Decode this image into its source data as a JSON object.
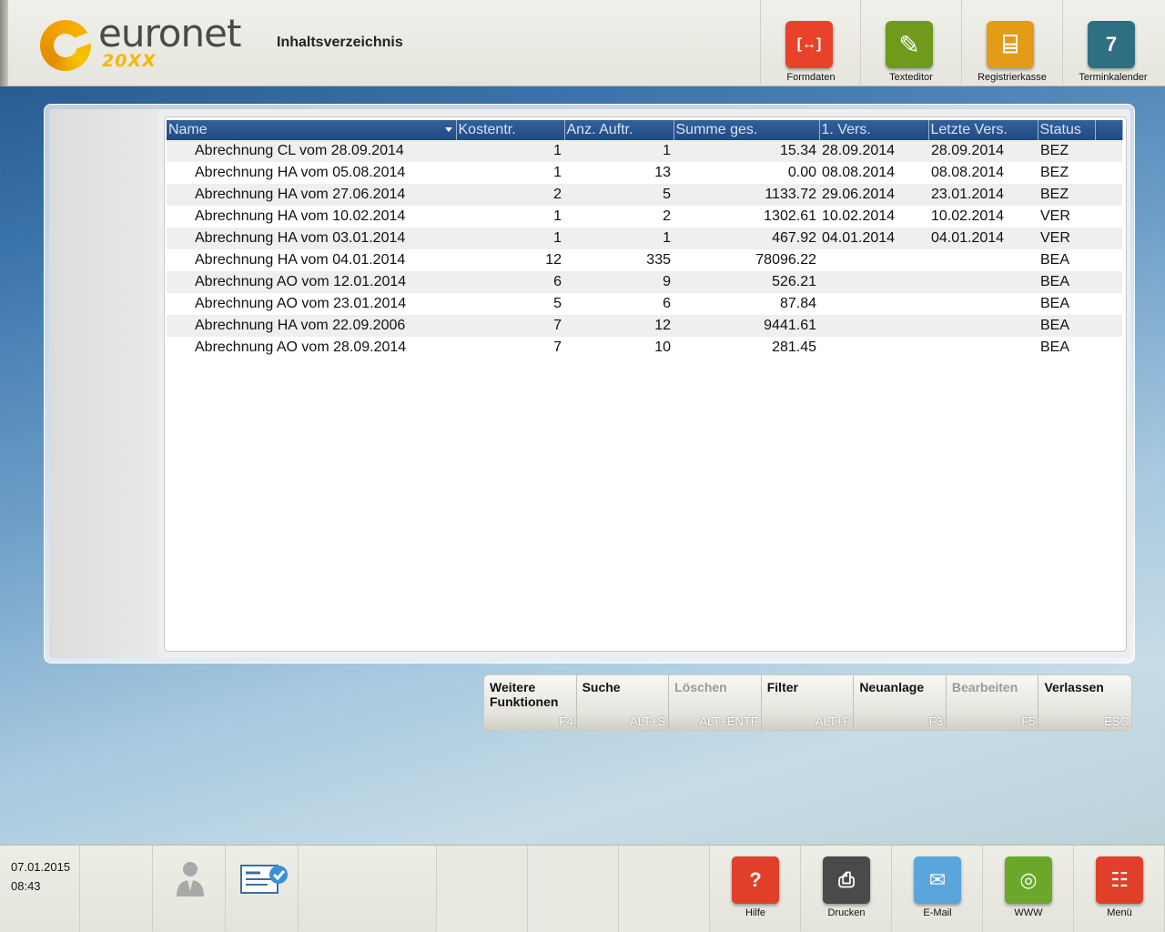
{
  "header": {
    "logo_text": "euronet",
    "logo_sub": "20XX",
    "title": "Inhaltsverzeichnis",
    "tools": [
      {
        "label": "Formdaten",
        "color": "#e8422a",
        "glyph": "[↔]"
      },
      {
        "label": "Texteditor",
        "color": "#6f9a1c",
        "glyph": "✎"
      },
      {
        "label": "Registrierkasse",
        "color": "#e49b18",
        "glyph": "⌸"
      },
      {
        "label": "Terminkalender",
        "color": "#2f6f84",
        "glyph": "7"
      }
    ]
  },
  "table": {
    "columns": [
      "Name",
      "Kostentr.",
      "Anz. Auftr.",
      "Summe ges.",
      "1. Vers.",
      "Letzte Vers.",
      "Status"
    ],
    "rows": [
      [
        "Abrechnung CL vom 28.09.2014",
        "1",
        "1",
        "15.34",
        "28.09.2014",
        "28.09.2014",
        "BEZ"
      ],
      [
        "Abrechnung HA vom 05.08.2014",
        "1",
        "13",
        "0.00",
        "08.08.2014",
        "08.08.2014",
        "BEZ"
      ],
      [
        "Abrechnung HA vom 27.06.2014",
        "2",
        "5",
        "1133.72",
        "29.06.2014",
        "23.01.2014",
        "BEZ"
      ],
      [
        "Abrechnung HA vom 10.02.2014",
        "1",
        "2",
        "1302.61",
        "10.02.2014",
        "10.02.2014",
        "VER"
      ],
      [
        "Abrechnung HA vom 03.01.2014",
        "1",
        "1",
        "467.92",
        "04.01.2014",
        "04.01.2014",
        "VER"
      ],
      [
        "Abrechnung HA vom 04.01.2014",
        "12",
        "335",
        "78096.22",
        "",
        "",
        "BEA"
      ],
      [
        "Abrechnung AO vom 12.01.2014",
        "6",
        "9",
        "526.21",
        "",
        "",
        "BEA"
      ],
      [
        "Abrechnung AO vom 23.01.2014",
        "5",
        "6",
        "87.84",
        "",
        "",
        "BEA"
      ],
      [
        "Abrechnung HA vom 22.09.2006",
        "7",
        "12",
        "9441.61",
        "",
        "",
        "BEA"
      ],
      [
        "Abrechnung AO vom 28.09.2014",
        "7",
        "10",
        "281.45",
        "",
        "",
        "BEA"
      ]
    ]
  },
  "functions": [
    {
      "label": "Weitere\nFunktionen",
      "key": "F4",
      "enabled": true
    },
    {
      "label": "Suche",
      "key": "ALT+S",
      "enabled": true
    },
    {
      "label": "Löschen",
      "key": "ALT+ENTF",
      "enabled": false
    },
    {
      "label": "Filter",
      "key": "ALT+F",
      "enabled": true
    },
    {
      "label": "Neuanlage",
      "key": "F3",
      "enabled": true
    },
    {
      "label": "Bearbeiten",
      "key": "F5",
      "enabled": false
    },
    {
      "label": "Verlassen",
      "key": "ESC",
      "enabled": true
    }
  ],
  "footer": {
    "date": "07.01.2015",
    "time": "08:43",
    "buttons": [
      {
        "label": "Hilfe",
        "color": "#e0402a",
        "glyph": "?"
      },
      {
        "label": "Drucken",
        "color": "#4a4a4a",
        "glyph": "⎙"
      },
      {
        "label": "E-Mail",
        "color": "#5aa6dc",
        "glyph": "✉"
      },
      {
        "label": "WWW",
        "color": "#6ba82a",
        "glyph": "◎"
      },
      {
        "label": "Menü",
        "color": "#e0402a",
        "glyph": "☷"
      }
    ]
  }
}
